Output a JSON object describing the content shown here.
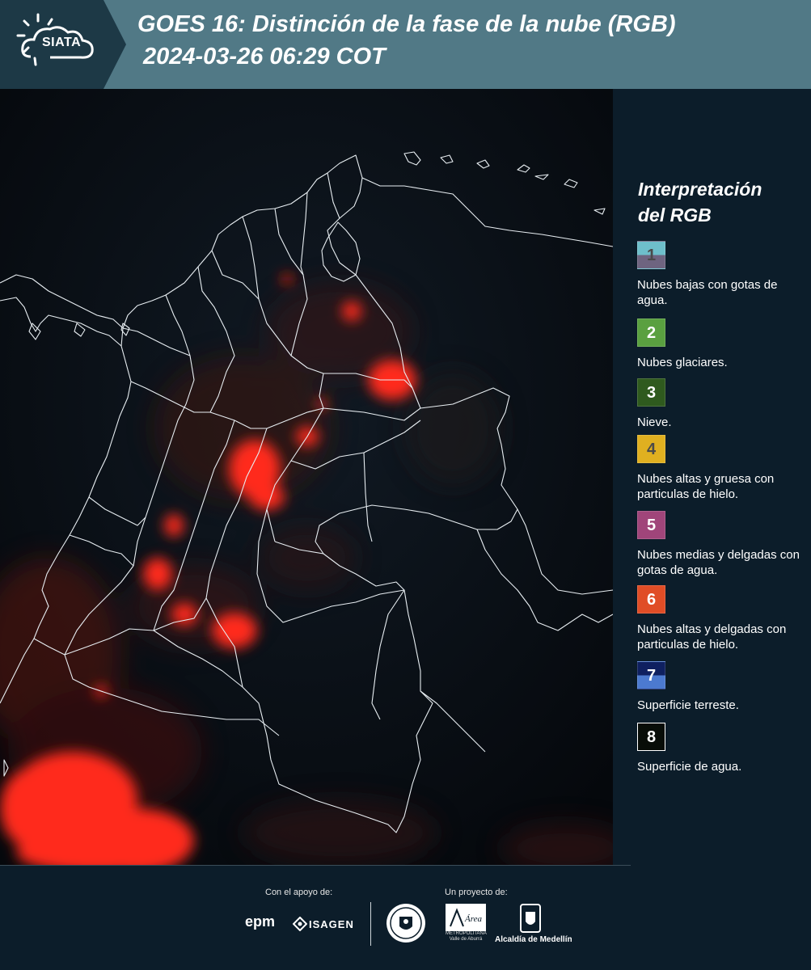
{
  "header": {
    "logo_text": "SIATA",
    "title_line1": "GOES 16: Distinción de la fase de la nube (RGB)",
    "title_line2": "2024-03-26 06:29 COT",
    "colors": {
      "header_bg": "#517986",
      "logo_bg": "#1d3946"
    }
  },
  "legend": {
    "title_line1": "Interpretación",
    "title_line2": "del RGB",
    "items": [
      {
        "number": "1",
        "label": "Nubes bajas con gotas de agua.",
        "top_color": "#6ebfcb",
        "bottom_color": "#6e6480",
        "number_color": "#4a4a4a"
      },
      {
        "number": "2",
        "label": "Nubes glaciares.",
        "top_color": "#5aa040",
        "bottom_color": "#5aa040",
        "number_color": "#ffffff"
      },
      {
        "number": "3",
        "label": "Nieve.",
        "top_color": "#2f5a1e",
        "bottom_color": "#2f5a1e",
        "number_color": "#ffffff"
      },
      {
        "number": "4",
        "label": "Nubes altas y gruesa con particulas de hielo.",
        "top_color": "#e0b020",
        "bottom_color": "#e0b020",
        "number_color": "#4a4a4a"
      },
      {
        "number": "5",
        "label": "Nubes medias y delgadas con gotas de agua.",
        "top_color": "#a0457a",
        "bottom_color": "#a0457a",
        "number_color": "#ffffff"
      },
      {
        "number": "6",
        "label": "Nubes altas y delgadas con particulas de hielo.",
        "top_color": "#e04d26",
        "bottom_color": "#e04d26",
        "number_color": "#ffffff"
      },
      {
        "number": "7",
        "label": "Superficie terreste.",
        "top_color": "#0f2060",
        "bottom_color": "#4c7ad0",
        "number_color": "#ffffff"
      },
      {
        "number": "8",
        "label": "Superficie de agua.",
        "top_color": "#080d08",
        "bottom_color": "#080d08",
        "number_color": "#ffffff"
      }
    ]
  },
  "footer": {
    "support_caption": "Con el apoyo de:",
    "project_caption": "Un proyecto de:",
    "sponsor_1": "epm",
    "sponsor_2": "ISAGEN",
    "partner_area": "Área",
    "partner_area_sub": "METROPOLITANA Valle de Aburrá",
    "partner_alcaldia": "Alcaldía de Medellín"
  },
  "map": {
    "icon": "satellite-rgb-map",
    "colors": {
      "cloud_red": "#ff2a1a",
      "boundary": "#e8eef2",
      "background": "#060a0f"
    }
  }
}
